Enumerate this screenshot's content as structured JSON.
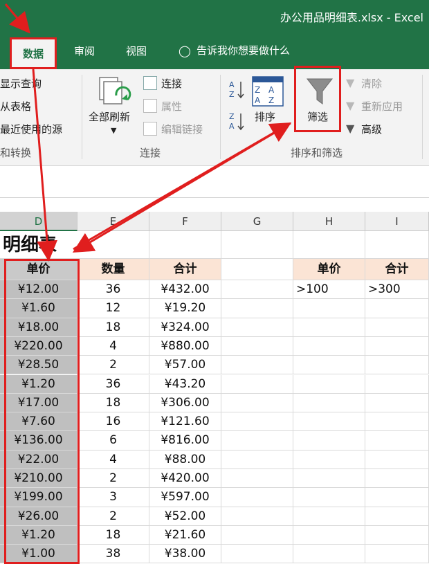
{
  "window": {
    "title": "办公用品明细表.xlsx - Excel"
  },
  "tabs": {
    "active": "数据",
    "review": "审阅",
    "view": "视图",
    "tell_me": "告诉我你想要做什么"
  },
  "ribbon": {
    "get_transform": {
      "items": [
        "显示查询",
        "从表格",
        "最近使用的源"
      ],
      "group": "和转换"
    },
    "connections": {
      "refresh_all": "全部刷新",
      "items": [
        "连接",
        "属性",
        "编辑链接"
      ],
      "group": "连接"
    },
    "sort_filter": {
      "sort": "排序",
      "filter": "筛选",
      "clear": "清除",
      "reapply": "重新应用",
      "advanced": "高级",
      "group": "排序和筛选"
    }
  },
  "columns": [
    "D",
    "E",
    "F",
    "G",
    "H",
    "I"
  ],
  "sheet": {
    "title_partial": "明细表",
    "headers": {
      "price": "单价",
      "qty": "数量",
      "total": "合计"
    },
    "criteria": {
      "price_header": "单价",
      "total_header": "合计",
      "price_value": ">100",
      "total_value": ">300"
    },
    "rows": [
      [
        "¥12.00",
        "36",
        "¥432.00"
      ],
      [
        "¥1.60",
        "12",
        "¥19.20"
      ],
      [
        "¥18.00",
        "18",
        "¥324.00"
      ],
      [
        "¥220.00",
        "4",
        "¥880.00"
      ],
      [
        "¥28.50",
        "2",
        "¥57.00"
      ],
      [
        "¥1.20",
        "36",
        "¥43.20"
      ],
      [
        "¥17.00",
        "18",
        "¥306.00"
      ],
      [
        "¥7.60",
        "16",
        "¥121.60"
      ],
      [
        "¥136.00",
        "6",
        "¥816.00"
      ],
      [
        "¥22.00",
        "4",
        "¥88.00"
      ],
      [
        "¥210.00",
        "2",
        "¥420.00"
      ],
      [
        "¥199.00",
        "3",
        "¥597.00"
      ],
      [
        "¥26.00",
        "2",
        "¥52.00"
      ],
      [
        "¥1.20",
        "18",
        "¥21.60"
      ],
      [
        "¥1.00",
        "38",
        "¥38.00"
      ]
    ]
  },
  "colors": {
    "excel_green": "#217346",
    "annotation_red": "#e01e1e",
    "header_fill": "#fbe4d5",
    "selection_gray": "#bfbfbf"
  }
}
